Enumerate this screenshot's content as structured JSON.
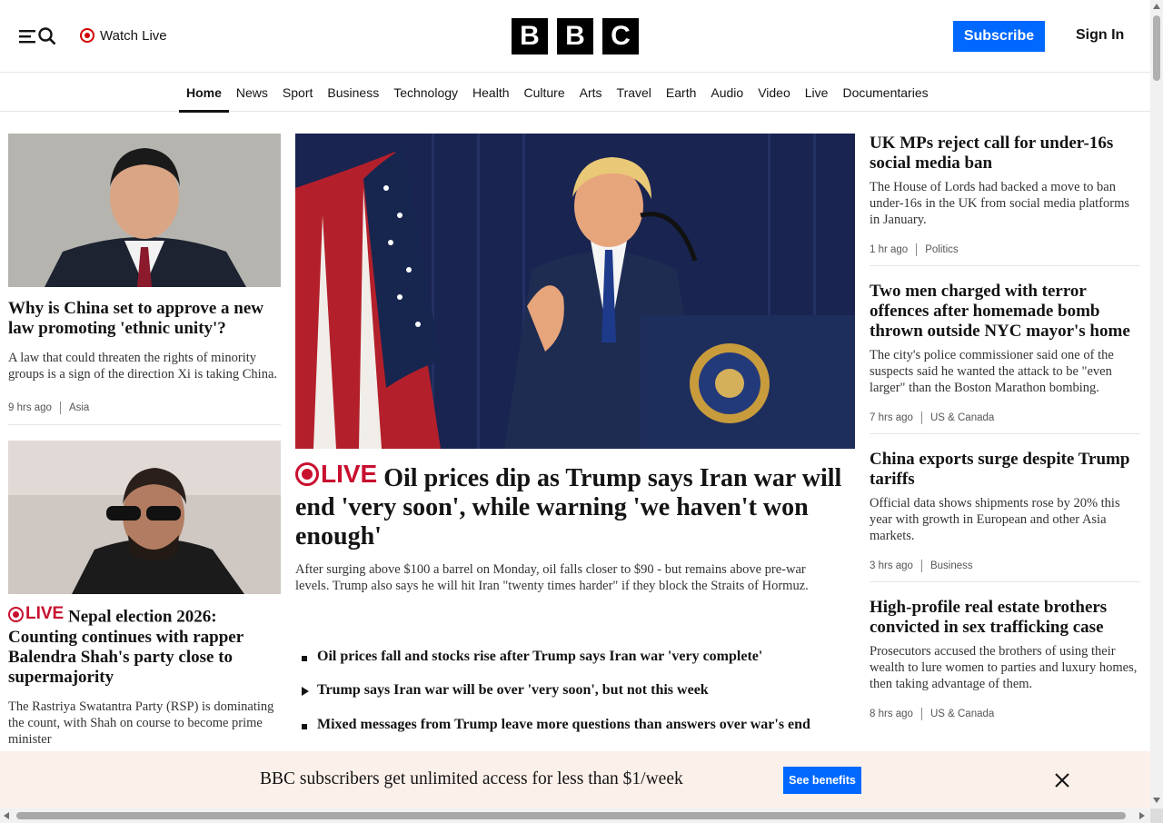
{
  "header": {
    "watch_live_label": "Watch Live",
    "logo_letters": [
      "B",
      "B",
      "C"
    ],
    "subscribe_label": "Subscribe",
    "signin_label": "Sign In"
  },
  "nav": {
    "items": [
      "Home",
      "News",
      "Sport",
      "Business",
      "Technology",
      "Health",
      "Culture",
      "Arts",
      "Travel",
      "Earth",
      "Audio",
      "Video",
      "Live",
      "Documentaries"
    ],
    "active": "Home"
  },
  "left": {
    "card1": {
      "headline": "Why is China set to approve a new law promoting 'ethnic unity'?",
      "summary": "A law that could threaten the rights of minority groups is a sign of the direction Xi is taking China.",
      "time": "9 hrs ago",
      "category": "Asia"
    },
    "card2": {
      "live_label": "LIVE",
      "headline": "Nepal election 2026: Counting continues with rapper Balendra Shah's party close to supermajority",
      "summary": "The Rastriya Swatantra Party (RSP) is dominating the count, with Shah on course to become prime minister"
    }
  },
  "main": {
    "live_label": "LIVE",
    "headline": "Oil prices dip as Trump says Iran war will end 'very soon', while warning 'we haven't won enough'",
    "summary": "After surging above $100 a barrel on Monday, oil falls closer to $90 - but remains above pre-war levels. Trump also says he will hit Iran \"twenty times harder\" if they block the Straits of Hormuz.",
    "related": [
      {
        "text": "Oil prices fall and stocks rise after Trump says Iran war 'very complete'",
        "icon": "square-bullet"
      },
      {
        "text": "Trump says Iran war will be over 'very soon', but not this week",
        "icon": "play-icon"
      },
      {
        "text": "Mixed messages from Trump leave more questions than answers over war's end",
        "icon": "square-bullet"
      }
    ]
  },
  "right": {
    "items": [
      {
        "headline": "UK MPs reject call for under-16s social media ban",
        "summary": "The House of Lords had backed a move to ban under-16s in the UK from social media platforms in January.",
        "time": "1 hr ago",
        "category": "Politics"
      },
      {
        "headline": "Two men charged with terror offences after homemade bomb thrown outside NYC mayor's home",
        "summary": "The city's police commissioner said one of the suspects said he wanted the attack to be \"even larger\" than the Boston Marathon bombing.",
        "time": "7 hrs ago",
        "category": "US & Canada"
      },
      {
        "headline": "China exports surge despite Trump tariffs",
        "summary": "Official data shows shipments rose by 20% this year with growth in European and other Asia markets.",
        "time": "3 hrs ago",
        "category": "Business"
      },
      {
        "headline": "High-profile real estate brothers convicted in sex trafficking case",
        "summary": "Prosecutors accused the brothers of using their wealth to lure women to parties and luxury homes, then taking advantage of them.",
        "time": "8 hrs ago",
        "category": "US & Canada"
      }
    ]
  },
  "promo": {
    "text": "BBC subscribers get unlimited access for less than $1/week",
    "button_label": "See benefits"
  },
  "colors": {
    "accent_blue": "#0068ff",
    "live_red": "#c8102e",
    "promo_bg": "#fbf0ea"
  }
}
